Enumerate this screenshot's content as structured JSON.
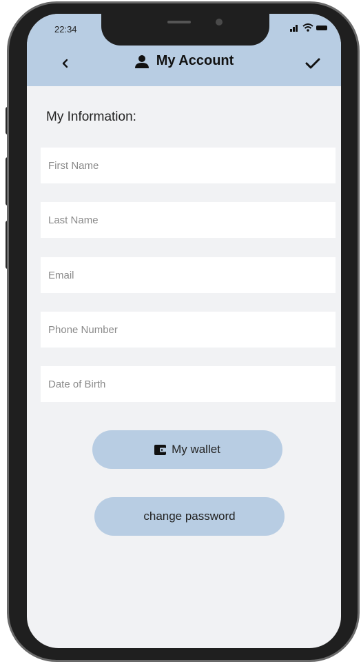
{
  "status_bar": {
    "time": "22:34",
    "icons": [
      "signal-icon",
      "wifi-icon",
      "battery-icon"
    ]
  },
  "header": {
    "title": "My Account",
    "icons": {
      "back": "chevron-left-icon",
      "title": "person-icon",
      "confirm": "checkmark-icon"
    }
  },
  "form": {
    "section_title": "My Information:",
    "fields": [
      {
        "placeholder": "First Name",
        "value": ""
      },
      {
        "placeholder": "Last Name",
        "value": ""
      },
      {
        "placeholder": "Email",
        "value": ""
      },
      {
        "placeholder": "Phone Number",
        "value": ""
      },
      {
        "placeholder": "Date of Birth",
        "value": ""
      }
    ]
  },
  "actions": {
    "wallet_label": "My wallet",
    "wallet_icon": "wallet-icon",
    "change_password_label": "change password"
  },
  "colors": {
    "header_bg": "#b8cde3",
    "screen_bg": "#f1f2f4",
    "button_bg": "#b8cde3",
    "phone_body": "#1f1f1f"
  }
}
